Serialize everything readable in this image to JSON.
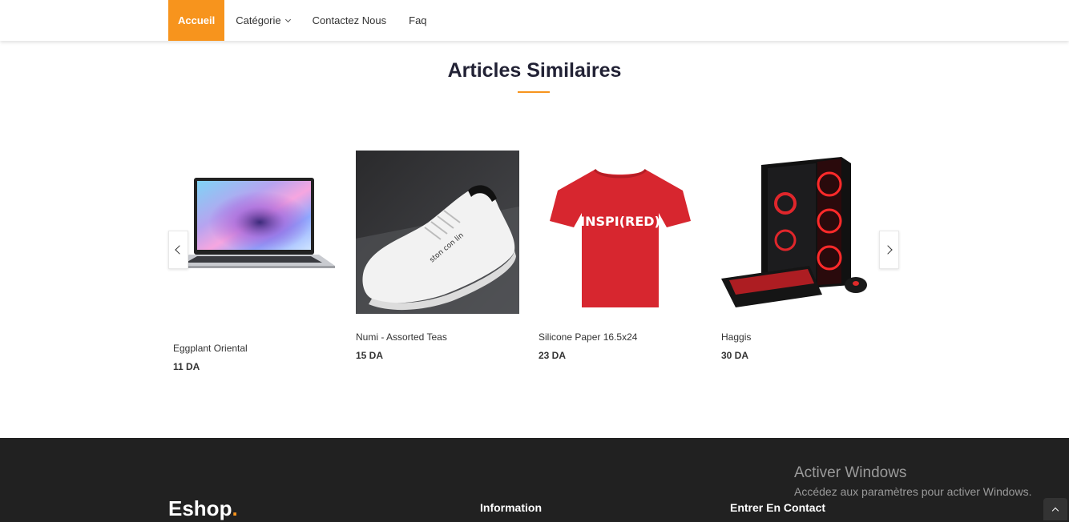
{
  "nav": {
    "items": [
      {
        "label": "Accueil",
        "active": true
      },
      {
        "label": "Catégorie",
        "dropdown": true
      },
      {
        "label": "Contactez Nous"
      },
      {
        "label": "Faq"
      }
    ]
  },
  "section": {
    "title": "Articles Similaires"
  },
  "products": [
    {
      "name": "Eggplant Oriental",
      "price": "11 DA",
      "image": "laptop"
    },
    {
      "name": "Numi - Assorted Teas",
      "price": "15 DA",
      "image": "white-sneaker"
    },
    {
      "name": "Silicone Paper 16.5x24",
      "price": "23 DA",
      "image": "red-tshirt",
      "shirt_text": "INSPI(RED)"
    },
    {
      "name": "Haggis",
      "price": "30 DA",
      "image": "gaming-pc"
    }
  ],
  "footer": {
    "logo": "Eshop",
    "logo_dot": ".",
    "col_information": "Information",
    "col_contact": "Entrer En Contact"
  },
  "windows_watermark": {
    "line1": "Activer Windows",
    "line2": "Accédez aux paramètres pour activer Windows."
  },
  "colors": {
    "accent": "#f7941d",
    "footer_bg": "#212121",
    "title": "#222235"
  }
}
